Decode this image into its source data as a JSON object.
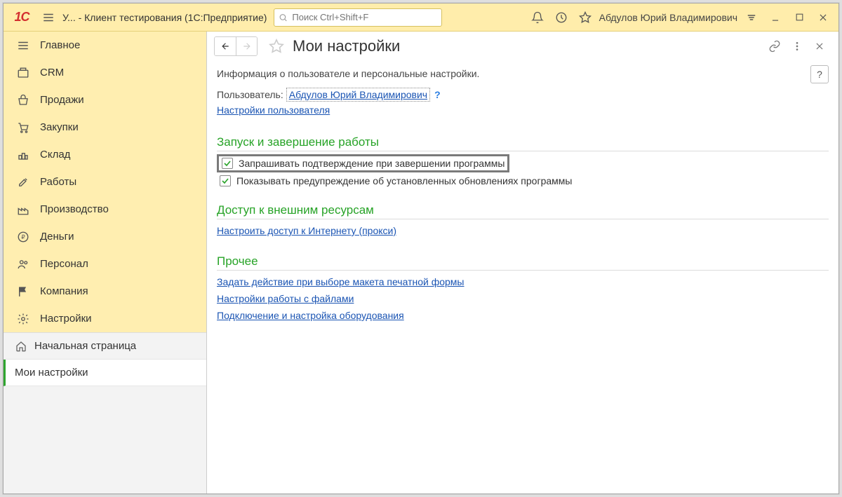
{
  "titlebar": {
    "app_short": "У...",
    "app_title": " - Клиент тестирования (1С:Предприятие)",
    "search_placeholder": "Поиск Ctrl+Shift+F",
    "user": "Абдулов Юрий Владимирович"
  },
  "sidebar": {
    "items": [
      {
        "label": "Главное"
      },
      {
        "label": "CRM"
      },
      {
        "label": "Продажи"
      },
      {
        "label": "Закупки"
      },
      {
        "label": "Склад"
      },
      {
        "label": "Работы"
      },
      {
        "label": "Производство"
      },
      {
        "label": "Деньги"
      },
      {
        "label": "Персонал"
      },
      {
        "label": "Компания"
      },
      {
        "label": "Настройки"
      }
    ],
    "opened": [
      {
        "label": "Начальная страница"
      },
      {
        "label": "Мои настройки"
      }
    ]
  },
  "page": {
    "title": "Мои настройки",
    "subtitle": "Информация о пользователе и персональные настройки.",
    "user_label": "Пользователь:",
    "user_value": "Абдулов Юрий Владимирович",
    "user_q": "?",
    "user_settings_link": "Настройки пользователя",
    "help": "?",
    "sections": {
      "startup": {
        "title": "Запуск и завершение работы",
        "check1": "Запрашивать подтверждение при завершении программы",
        "check2": "Показывать предупреждение об установленных обновлениях программы"
      },
      "external": {
        "title": "Доступ к внешним ресурсам",
        "link1": "Настроить доступ к Интернету (прокси)"
      },
      "other": {
        "title": "Прочее",
        "link1": "Задать действие при выборе макета печатной формы",
        "link2": "Настройки работы с файлами",
        "link3": "Подключение и настройка оборудования"
      }
    }
  }
}
